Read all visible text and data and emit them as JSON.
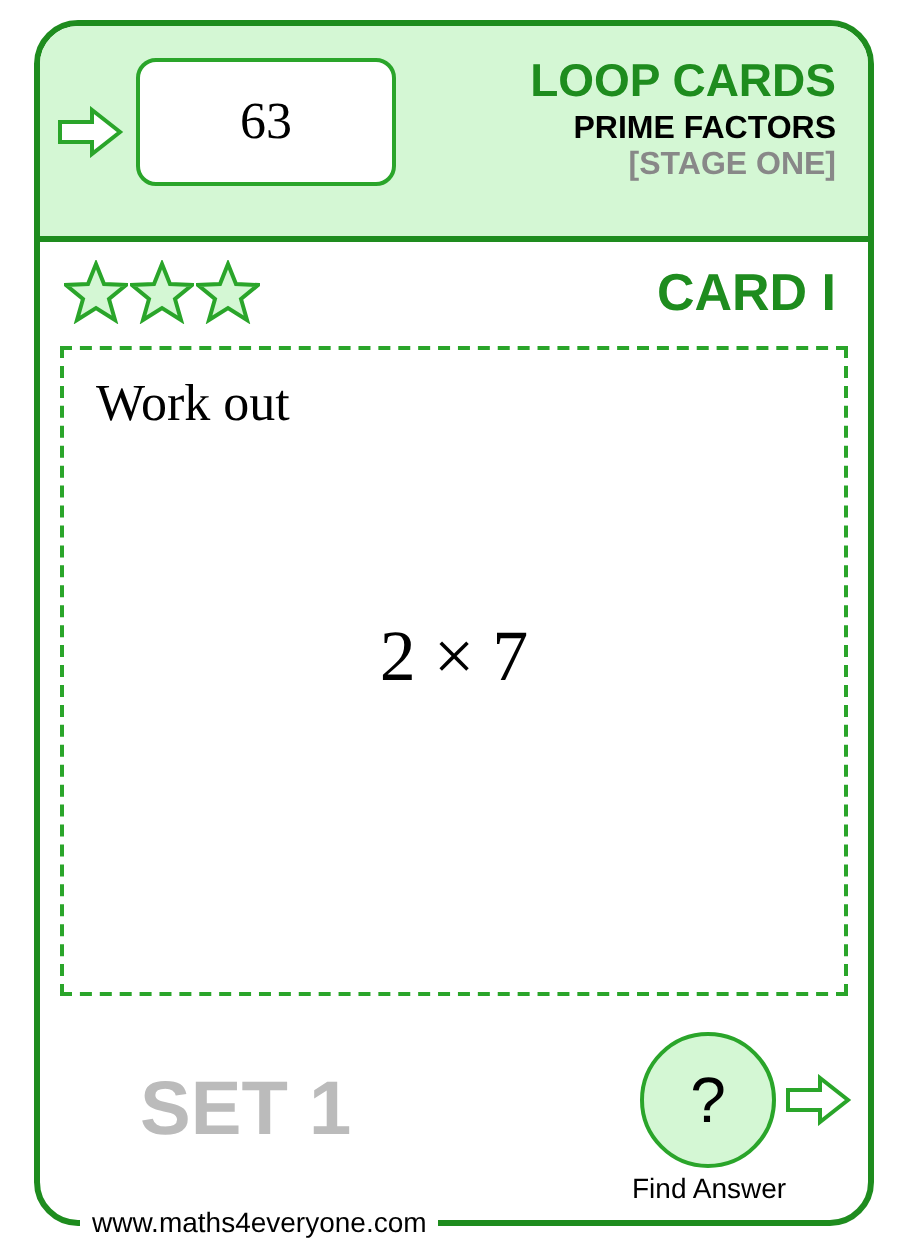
{
  "header": {
    "answer_value": "63",
    "title": "LOOP CARDS",
    "subtitle": "PRIME FACTORS",
    "stage": "[STAGE ONE]"
  },
  "card": {
    "stars": 3,
    "label": "CARD I",
    "prompt": "Work out",
    "expression": "2 × 7"
  },
  "footer": {
    "set": "SET 1",
    "button_symbol": "?",
    "button_label": "Find Answer",
    "website": "www.maths4everyone.com"
  }
}
